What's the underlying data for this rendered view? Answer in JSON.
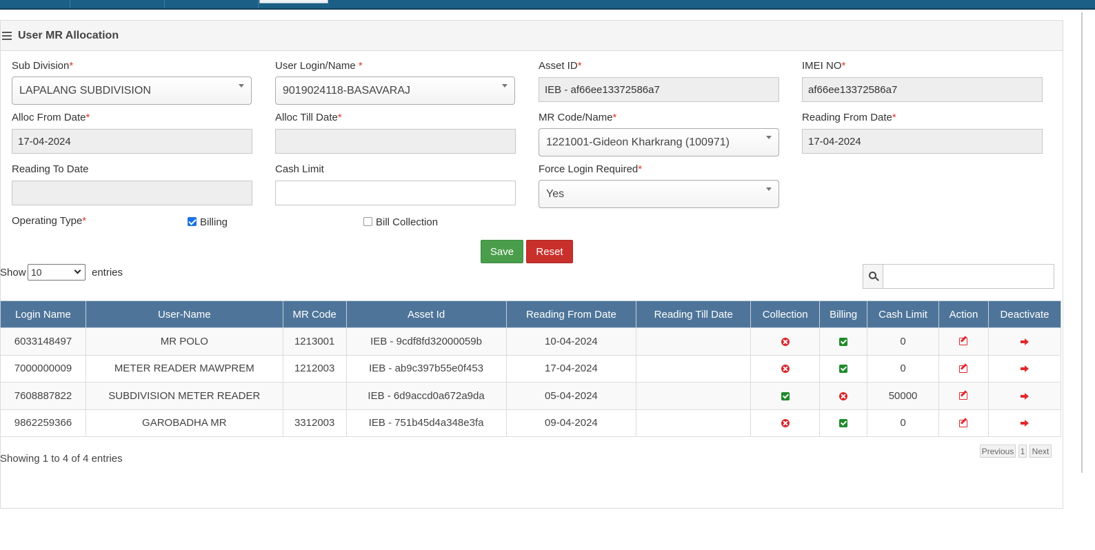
{
  "panel": {
    "title": "User MR Allocation"
  },
  "form": {
    "sub_division": {
      "label": "Sub Division",
      "required": "*",
      "value": "LAPALANG SUBDIVISION"
    },
    "user_login": {
      "label": "User Login/Name ",
      "required": "*",
      "value": "9019024118-BASAVARAJ"
    },
    "asset_id": {
      "label": "Asset ID",
      "required": "*",
      "value": "IEB - af66ee13372586a7"
    },
    "imei": {
      "label": "IMEI NO",
      "required": "*",
      "value": "af66ee13372586a7"
    },
    "alloc_from": {
      "label": "Alloc From Date",
      "required": "*",
      "value": "17-04-2024"
    },
    "alloc_till": {
      "label": "Alloc Till Date",
      "required": "*",
      "value": ""
    },
    "mr_code": {
      "label": "MR Code/Name",
      "required": "*",
      "value": "1221001-Gideon Kharkrang (100971)"
    },
    "reading_from": {
      "label": "Reading From Date",
      "required": "*",
      "value": "17-04-2024"
    },
    "reading_to": {
      "label": "Reading To Date",
      "value": ""
    },
    "cash_limit": {
      "label": "Cash Limit",
      "value": ""
    },
    "force_login": {
      "label": "Force Login Required",
      "required": "*",
      "value": "Yes"
    },
    "operating_type": {
      "label": "Operating Type",
      "required": "*",
      "billing_label": "Billing",
      "billing_checked": true,
      "collection_label": "Bill Collection",
      "collection_checked": false
    },
    "save_label": "Save",
    "reset_label": "Reset"
  },
  "table_controls": {
    "show_label": "Show",
    "page_size": "10",
    "entries_label": "entries",
    "search_value": ""
  },
  "table": {
    "columns": [
      "Login Name",
      "User-Name",
      "MR Code",
      "Asset Id",
      "Reading From Date",
      "Reading Till Date",
      "Collection",
      "Billing",
      "Cash Limit",
      "Action",
      "Deactivate"
    ],
    "rows": [
      {
        "login": "6033148497",
        "user": "MR POLO",
        "mr_code": "1213001",
        "asset": "IEB - 9cdf8fd32000059b",
        "from": "10-04-2024",
        "till": "",
        "collection": false,
        "billing": true,
        "cash_limit": "0"
      },
      {
        "login": "7000000009",
        "user": "METER READER MAWPREM",
        "mr_code": "1212003",
        "asset": "IEB - ab9c397b55e0f453",
        "from": "17-04-2024",
        "till": "",
        "collection": false,
        "billing": true,
        "cash_limit": "0"
      },
      {
        "login": "7608887822",
        "user": "SUBDIVISION METER READER",
        "mr_code": "",
        "asset": "IEB - 6d9accd0a672a9da",
        "from": "05-04-2024",
        "till": "",
        "collection": true,
        "billing": false,
        "cash_limit": "50000"
      },
      {
        "login": "9862259366",
        "user": "GAROBADHA MR",
        "mr_code": "3312003",
        "asset": "IEB - 751b45d4a348e3fa",
        "from": "09-04-2024",
        "till": "",
        "collection": false,
        "billing": true,
        "cash_limit": "0"
      }
    ]
  },
  "footer": {
    "info": "Showing 1 to 4 of 4 entries",
    "prev": "Previous",
    "page": "1",
    "next": "Next"
  },
  "icons": {
    "yes": "check-square-icon",
    "no": "times-circle-icon",
    "edit": "edit-icon",
    "deactivate": "sign-out-icon",
    "menu": "bars-icon",
    "search": "search-icon"
  },
  "colors": {
    "header_bar": "#1c5f86",
    "table_header": "#4e7599",
    "save": "#4a9e4b",
    "reset": "#c9302c",
    "required": "#d9362b"
  }
}
